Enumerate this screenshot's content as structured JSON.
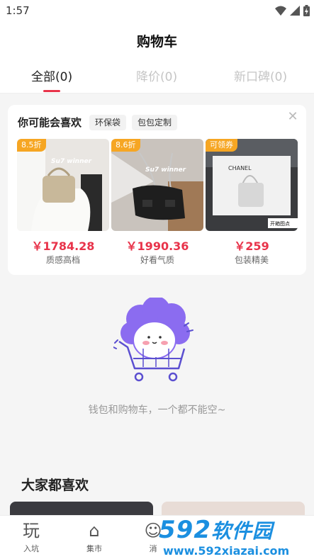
{
  "status_bar": {
    "time": "1:57",
    "icons": [
      "wifi-icon",
      "signal-icon",
      "battery-icon"
    ]
  },
  "header": {
    "title": "购物车",
    "tabs": [
      {
        "label": "全部(0)",
        "active": true
      },
      {
        "label": "降价(0)",
        "active": false
      },
      {
        "label": "新口碑(0)",
        "active": false
      }
    ]
  },
  "recommend": {
    "title": "你可能会喜欢",
    "tags": [
      "环保袋",
      "包包定制"
    ],
    "close_icon": "close-icon",
    "products": [
      {
        "badge": "8.5折",
        "image_text": "Su7 winner",
        "price": "￥1784.28",
        "name": "质感高档"
      },
      {
        "badge": "8.6折",
        "image_text": "Su7 winner",
        "price": "￥1990.36",
        "name": "好看气质"
      },
      {
        "badge": "可领券",
        "image_text": "CHANEL",
        "image_caption": "开箱图点",
        "price": "￥259",
        "name": "包装精美"
      }
    ]
  },
  "empty_state": {
    "illustration": "cart-mascot-illustration",
    "text": "钱包和购物车，一个都不能空~"
  },
  "feed": {
    "title": "大家都喜欢"
  },
  "bottom_nav": {
    "items": [
      {
        "label": "入坑",
        "icon": "play-icon",
        "glyph": "玩"
      },
      {
        "label": "集市",
        "icon": "market-icon",
        "glyph": "⌂"
      },
      {
        "label": "消",
        "icon": "message-icon",
        "glyph": "☺"
      }
    ]
  },
  "watermark": {
    "brand": "592",
    "brand_cn": "软件园",
    "url": "www.592xiazai.com"
  },
  "colors": {
    "accent": "#e8334a",
    "badge": "#f6a623",
    "mascot": "#8b6cf0",
    "watermark": "#1b8fe0"
  }
}
